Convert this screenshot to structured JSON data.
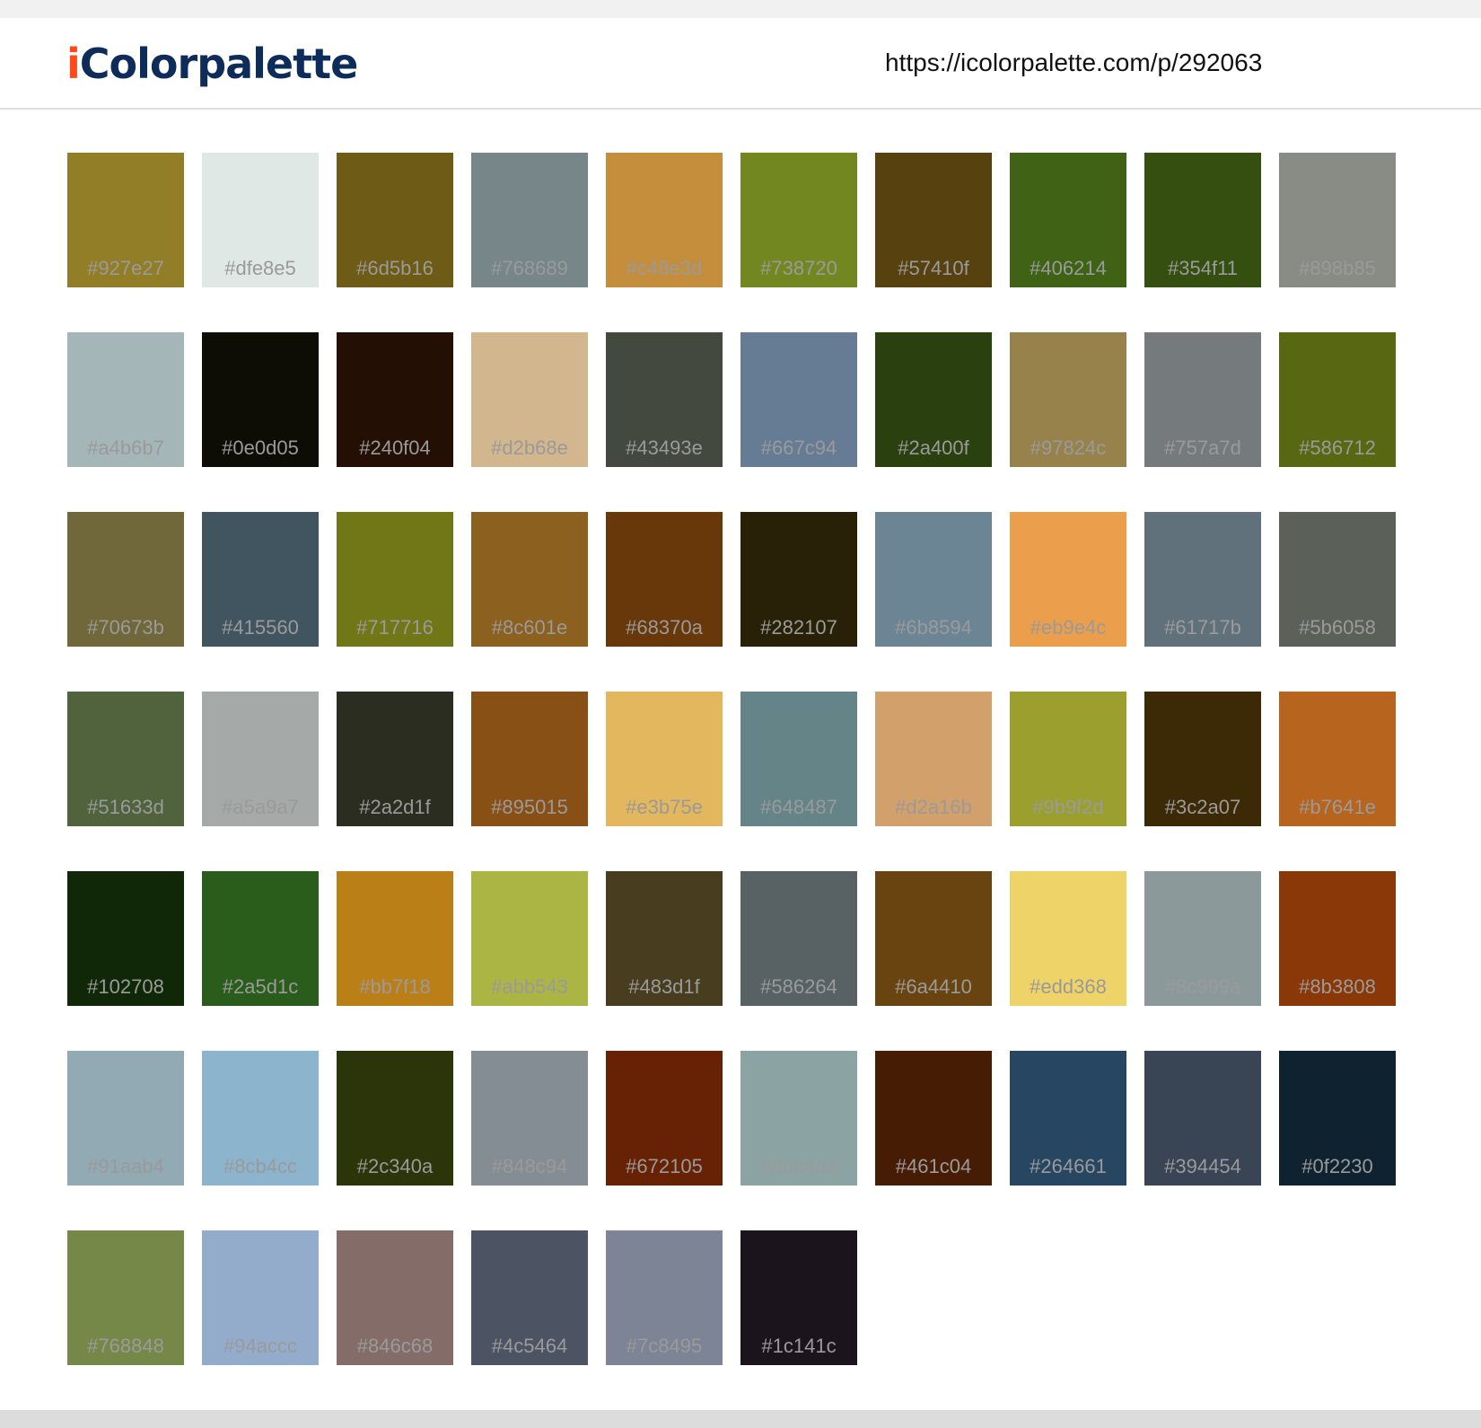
{
  "header": {
    "logo_i": "i",
    "logo_rest": "Colorpalette",
    "url": "https://icolorpalette.com/p/292063"
  },
  "swatches": [
    "#927e27",
    "#dfe8e5",
    "#6d5b16",
    "#768689",
    "#c48e3d",
    "#738720",
    "#57410f",
    "#406214",
    "#354f11",
    "#898b85",
    "#a4b6b7",
    "#0e0d05",
    "#240f04",
    "#d2b68e",
    "#43493e",
    "#667c94",
    "#2a400f",
    "#97824c",
    "#757a7d",
    "#586712",
    "#70673b",
    "#415560",
    "#717716",
    "#8c601e",
    "#68370a",
    "#282107",
    "#6b8594",
    "#eb9e4c",
    "#61717b",
    "#5b6058",
    "#51633d",
    "#a5a9a7",
    "#2a2d1f",
    "#895015",
    "#e3b75e",
    "#648487",
    "#d2a16b",
    "#9b9f2d",
    "#3c2a07",
    "#b7641e",
    "#102708",
    "#2a5d1c",
    "#bb7f18",
    "#abb543",
    "#483d1f",
    "#586264",
    "#6a4410",
    "#edd368",
    "#8c999a",
    "#8b3808",
    "#91aab4",
    "#8cb4cc",
    "#2c340a",
    "#848c94",
    "#672105",
    "#8ba4a3",
    "#461c04",
    "#264661",
    "#394454",
    "#0f2230",
    "#768848",
    "#94accc",
    "#846c68",
    "#4c5464",
    "#7c8495",
    "#1c141c"
  ]
}
